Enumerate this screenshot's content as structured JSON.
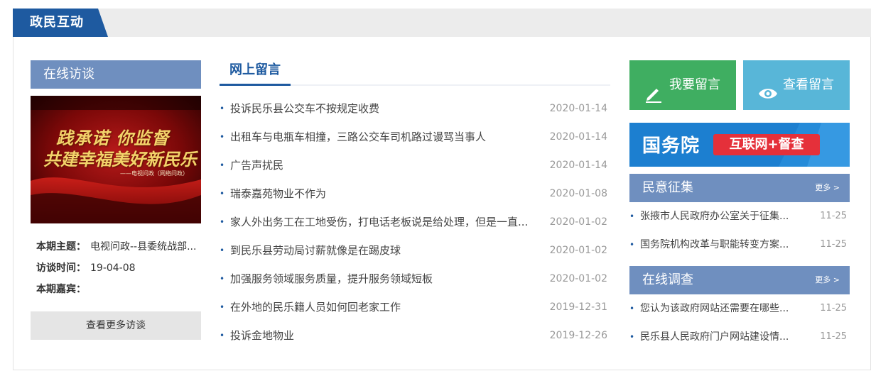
{
  "header": {
    "title": "政民互动"
  },
  "interview": {
    "section_title": "在线访谈",
    "image": {
      "line1": "践承诺 你监督",
      "line2": "共建幸福美好新民乐",
      "line3": "——电视问政（网络问政）"
    },
    "info": [
      {
        "label": "本期主题：",
        "value": "电视问政--县委统战部..."
      },
      {
        "label": "访谈时间：",
        "value": "19-04-08"
      },
      {
        "label": "本期嘉宾：",
        "value": ""
      }
    ],
    "more_button": "查看更多访谈"
  },
  "messages": {
    "section_title": "网上留言",
    "items": [
      {
        "title": "投诉民乐县公交车不按规定收费",
        "date": "2020-01-14"
      },
      {
        "title": "出租车与电瓶车相撞，三路公交车司机路过谩骂当事人",
        "date": "2020-01-14"
      },
      {
        "title": "广告声扰民",
        "date": "2020-01-14"
      },
      {
        "title": "瑞泰嘉苑物业不作为",
        "date": "2020-01-08"
      },
      {
        "title": "家人外出务工在工地受伤，打电话老板说是给处理，但是一直...",
        "date": "2020-01-02"
      },
      {
        "title": "到民乐县劳动局讨薪就像是在踢皮球",
        "date": "2020-01-02"
      },
      {
        "title": "加强服务领域服务质量，提升服务领域短板",
        "date": "2020-01-02"
      },
      {
        "title": "在外地的民乐籍人员如何回老家工作",
        "date": "2019-12-31"
      },
      {
        "title": "投诉金地物业",
        "date": "2019-12-26"
      }
    ]
  },
  "actions": {
    "write_label": "我要留言",
    "view_label": "查看留言"
  },
  "banner": {
    "left_text": "国务院",
    "pill_text": "互联网+督查"
  },
  "opinion": {
    "section_title": "民意征集",
    "more": "更多 >",
    "items": [
      {
        "title": "张掖市人民政府办公室关于征集...",
        "date": "11-25"
      },
      {
        "title": "国务院机构改革与职能转变方案...",
        "date": "11-25"
      }
    ]
  },
  "survey": {
    "section_title": "在线调查",
    "more": "更多 >",
    "items": [
      {
        "title": "您认为该政府网站还需要在哪些...",
        "date": "11-25"
      },
      {
        "title": "民乐县人民政府门户网站建设情...",
        "date": "11-25"
      }
    ]
  },
  "colors": {
    "brand_blue": "#1e5aa0",
    "section_head": "#6f8fbf",
    "write_green": "#3fae61",
    "view_cyan": "#58b6d8",
    "banner_blue": "#1c7fd0",
    "banner_red": "#e5303a"
  },
  "icons": {
    "write": "pencil-icon",
    "view": "eye-icon",
    "bullet": "dot-icon"
  }
}
